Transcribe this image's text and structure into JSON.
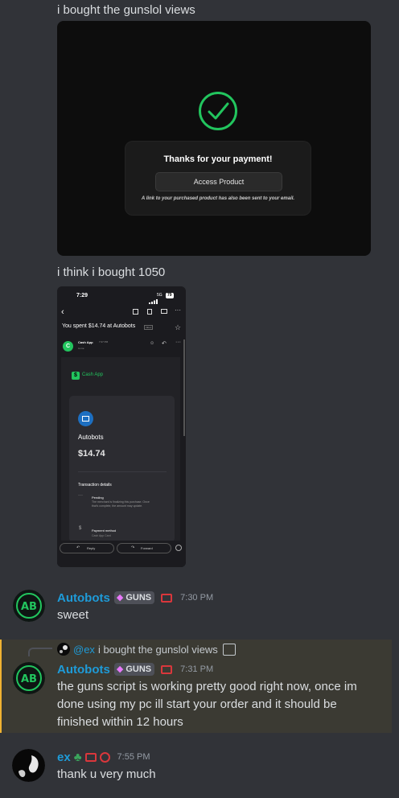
{
  "messages": {
    "m1_text": "i bought the gunslol views",
    "m2_text": "i think i bought 1050"
  },
  "payment_card": {
    "title": "Thanks for your payment!",
    "button": "Access Product",
    "note": "A link to your purchased product has also been sent to your email."
  },
  "phone": {
    "clock": "7:29",
    "network": "5G",
    "battery": "79",
    "subject": "You spent $14.74 at Autobots",
    "inbox_badge": "Inbox",
    "sender": "Cash App",
    "sender_time": "7:27 PM",
    "to_me": "to me",
    "brand": "Cash App",
    "merchant": "Autobots",
    "amount": "$14.74",
    "details_heading": "Transaction details",
    "status": "Pending",
    "status_desc": "The merchant is finalizing this purchase. Once that's complete, the amount may update.",
    "payment_method": "Payment method",
    "payment_method_value": "Cash App Card",
    "reply": "Reply",
    "forward": "Forward"
  },
  "autobots_msg1": {
    "username": "Autobots",
    "tag": "GUNS",
    "time": "7:30 PM",
    "text": "sweet"
  },
  "reply_ref": {
    "mention": "@ex",
    "preview": "i bought the gunslol views"
  },
  "autobots_msg2": {
    "username": "Autobots",
    "tag": "GUNS",
    "time": "7:31 PM",
    "line1": "the guns script is working pretty good right now, once im",
    "line2": "done using my pc ill start your order and it should be",
    "line3": "finished within 12 hours"
  },
  "ex_msg": {
    "username": "ex",
    "time": "7:55 PM",
    "text": "thank u very much"
  },
  "avatar_text": "AB",
  "colors": {
    "bg": "#313338",
    "username": "#1e9bd8",
    "reply_bar": "#f0b232",
    "green": "#22c55e"
  }
}
